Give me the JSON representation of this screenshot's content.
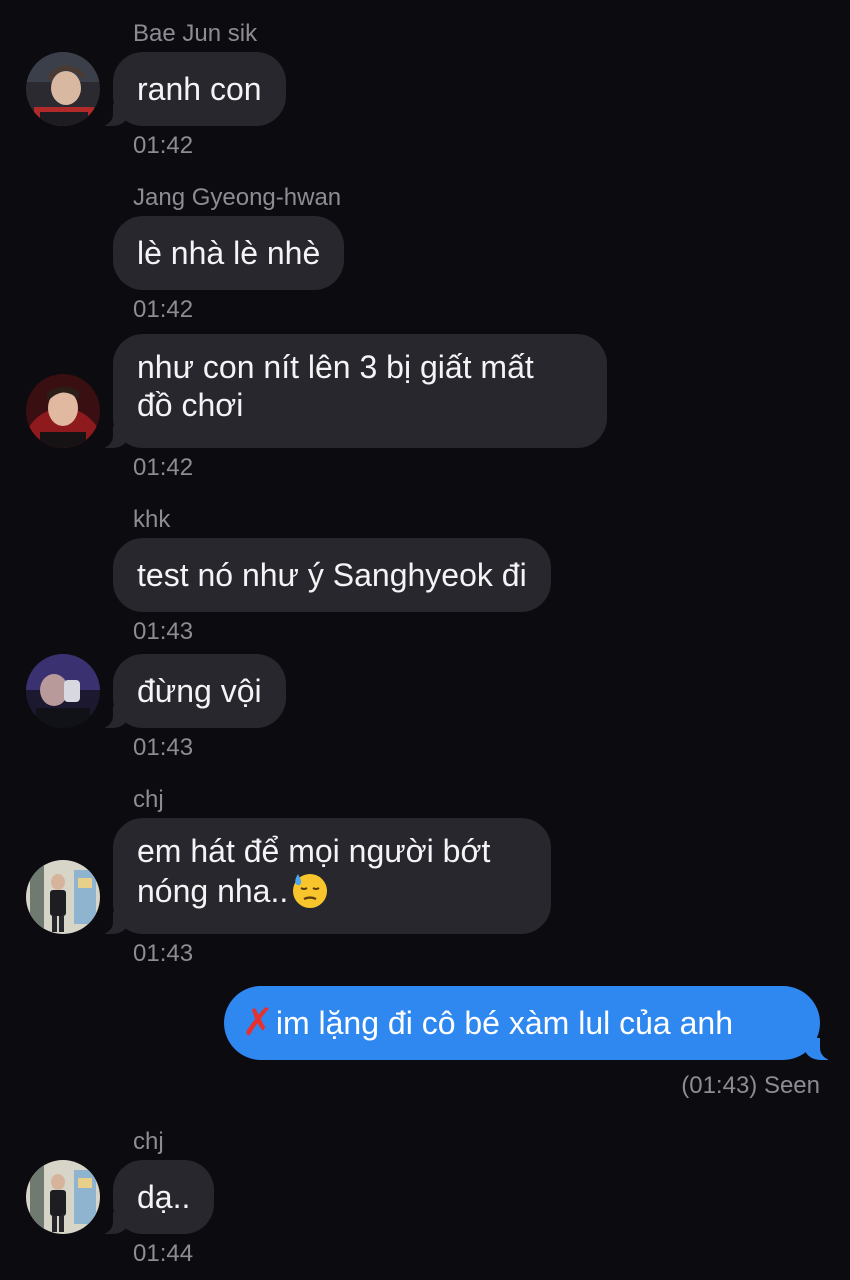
{
  "messages": [
    {
      "sender": "Bae Jun sik",
      "text": "ranh con",
      "time": "01:42",
      "avatar": "avatar-bae-jun-sik"
    },
    {
      "sender": "Jang Gyeong-hwan",
      "text": "lè nhà lè nhè",
      "time": "01:42"
    },
    {
      "line1": "như con nít lên 3 bị giất mất",
      "line2": "đồ chơi",
      "time": "01:42",
      "avatar": "avatar-jang-gyeong-hwan"
    },
    {
      "sender": "khk",
      "text": "test nó như ý Sanghyeok đi",
      "time": "01:43"
    },
    {
      "text": "đừng vội",
      "time": "01:43",
      "avatar": "avatar-khk"
    },
    {
      "sender": "chj",
      "line1": "em hát để mọi người bớt",
      "line2": "nóng nha..",
      "emoji": "downcast-sweat-face-icon",
      "time": "01:43",
      "avatar": "avatar-chj"
    },
    {
      "sender": "chj",
      "text": "dạ..",
      "time": "01:44",
      "avatar": "avatar-chj"
    }
  ],
  "outgoing": {
    "prefix_icon": "cross-mark-icon",
    "prefix_glyph": "✗",
    "text": "im lặng đi cô bé xàm lul của anh",
    "status": "(01:43) Seen"
  },
  "colors": {
    "background": "#0c0b10",
    "incoming_bubble": "#28272d",
    "outgoing_bubble": "#2f87f0",
    "meta_text": "#8d8c93",
    "cross_mark": "#e6312e"
  }
}
